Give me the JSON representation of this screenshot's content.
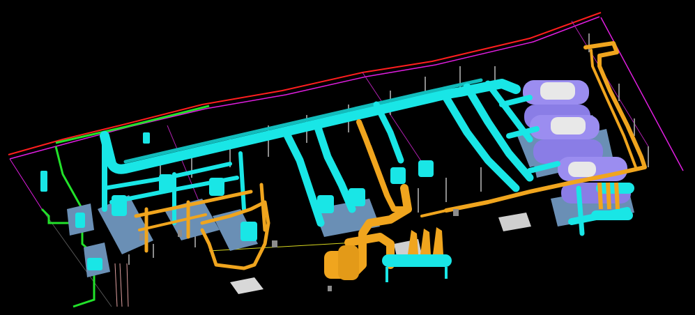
{
  "viewport": {
    "background": "#000000"
  },
  "scene": {
    "kind": "3D isometric plant-room piping model",
    "text_labels": [],
    "colors": {
      "chilled_water_pipe": "#19e6e6",
      "hot_water_pipe": "#f0a51e",
      "red_line": "#ff1e1e",
      "magenta_line": "#e01ee0",
      "green_line": "#22e22a",
      "equipment_base": "#6a8fb5",
      "chiller": "#9b8df0",
      "support_grey": "#8c8c8c",
      "grating": "#d8d8d8",
      "thin_pink_line": "#e0a0a0"
    },
    "component_icons": [
      "chiller-icon",
      "pump-icon",
      "heat-exchanger-icon",
      "header-icon",
      "floor-grating-icon",
      "pipe-support-icon"
    ]
  }
}
